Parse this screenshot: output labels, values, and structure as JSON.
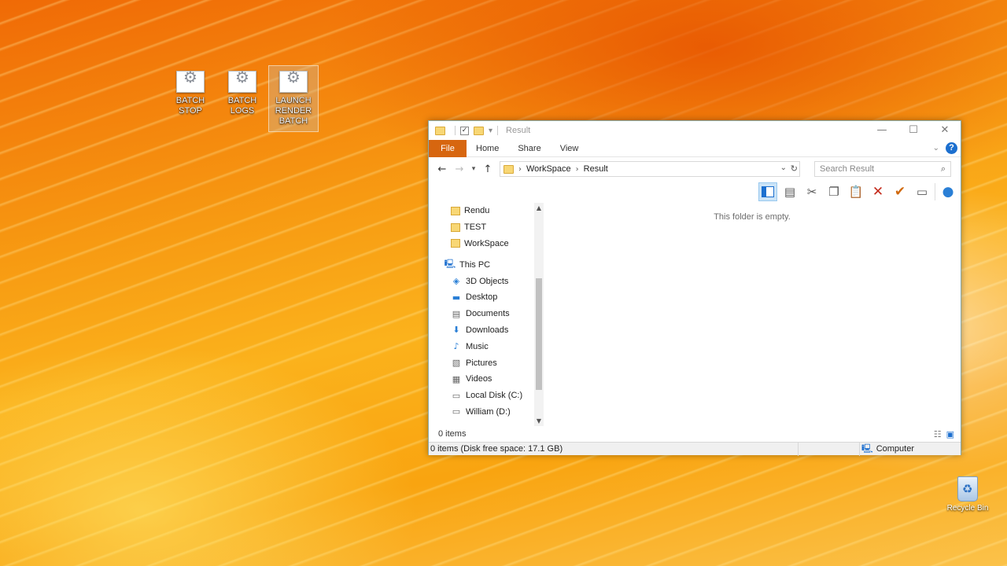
{
  "desktop": {
    "icons": [
      {
        "label": "BATCH STOP"
      },
      {
        "label": "BATCH LOGS"
      },
      {
        "label": "LAUNCH RENDER BATCH"
      }
    ],
    "recycle_bin": "Recycle Bin"
  },
  "window": {
    "title": "Result",
    "controls": {
      "minimize": "—",
      "maximize": "☐",
      "close": "✕"
    },
    "ribbon_tabs": [
      "File",
      "Home",
      "Share",
      "View"
    ],
    "address": {
      "crumbs": [
        "WorkSpace",
        "Result"
      ]
    },
    "search_placeholder": "Search Result",
    "nav_items": [
      {
        "label": "Rendu",
        "icon": "folder-icon"
      },
      {
        "label": "TEST",
        "icon": "folder-icon"
      },
      {
        "label": "WorkSpace",
        "icon": "folder-icon"
      },
      {
        "label": "This PC",
        "icon": "computer-icon"
      },
      {
        "label": "3D Objects",
        "icon": "cube-icon"
      },
      {
        "label": "Desktop",
        "icon": "desktop-icon"
      },
      {
        "label": "Documents",
        "icon": "document-icon"
      },
      {
        "label": "Downloads",
        "icon": "download-icon"
      },
      {
        "label": "Music",
        "icon": "music-icon"
      },
      {
        "label": "Pictures",
        "icon": "picture-icon"
      },
      {
        "label": "Videos",
        "icon": "video-icon"
      },
      {
        "label": "Local Disk (C:)",
        "icon": "drive-icon"
      },
      {
        "label": "William (D:)",
        "icon": "drive-icon"
      }
    ],
    "empty_message": "This folder is empty.",
    "status_items": "0 items",
    "bottom_status": "0 items (Disk free space: 17.1 GB)",
    "bottom_computer": "Computer",
    "accent_color": "#d7660f"
  }
}
